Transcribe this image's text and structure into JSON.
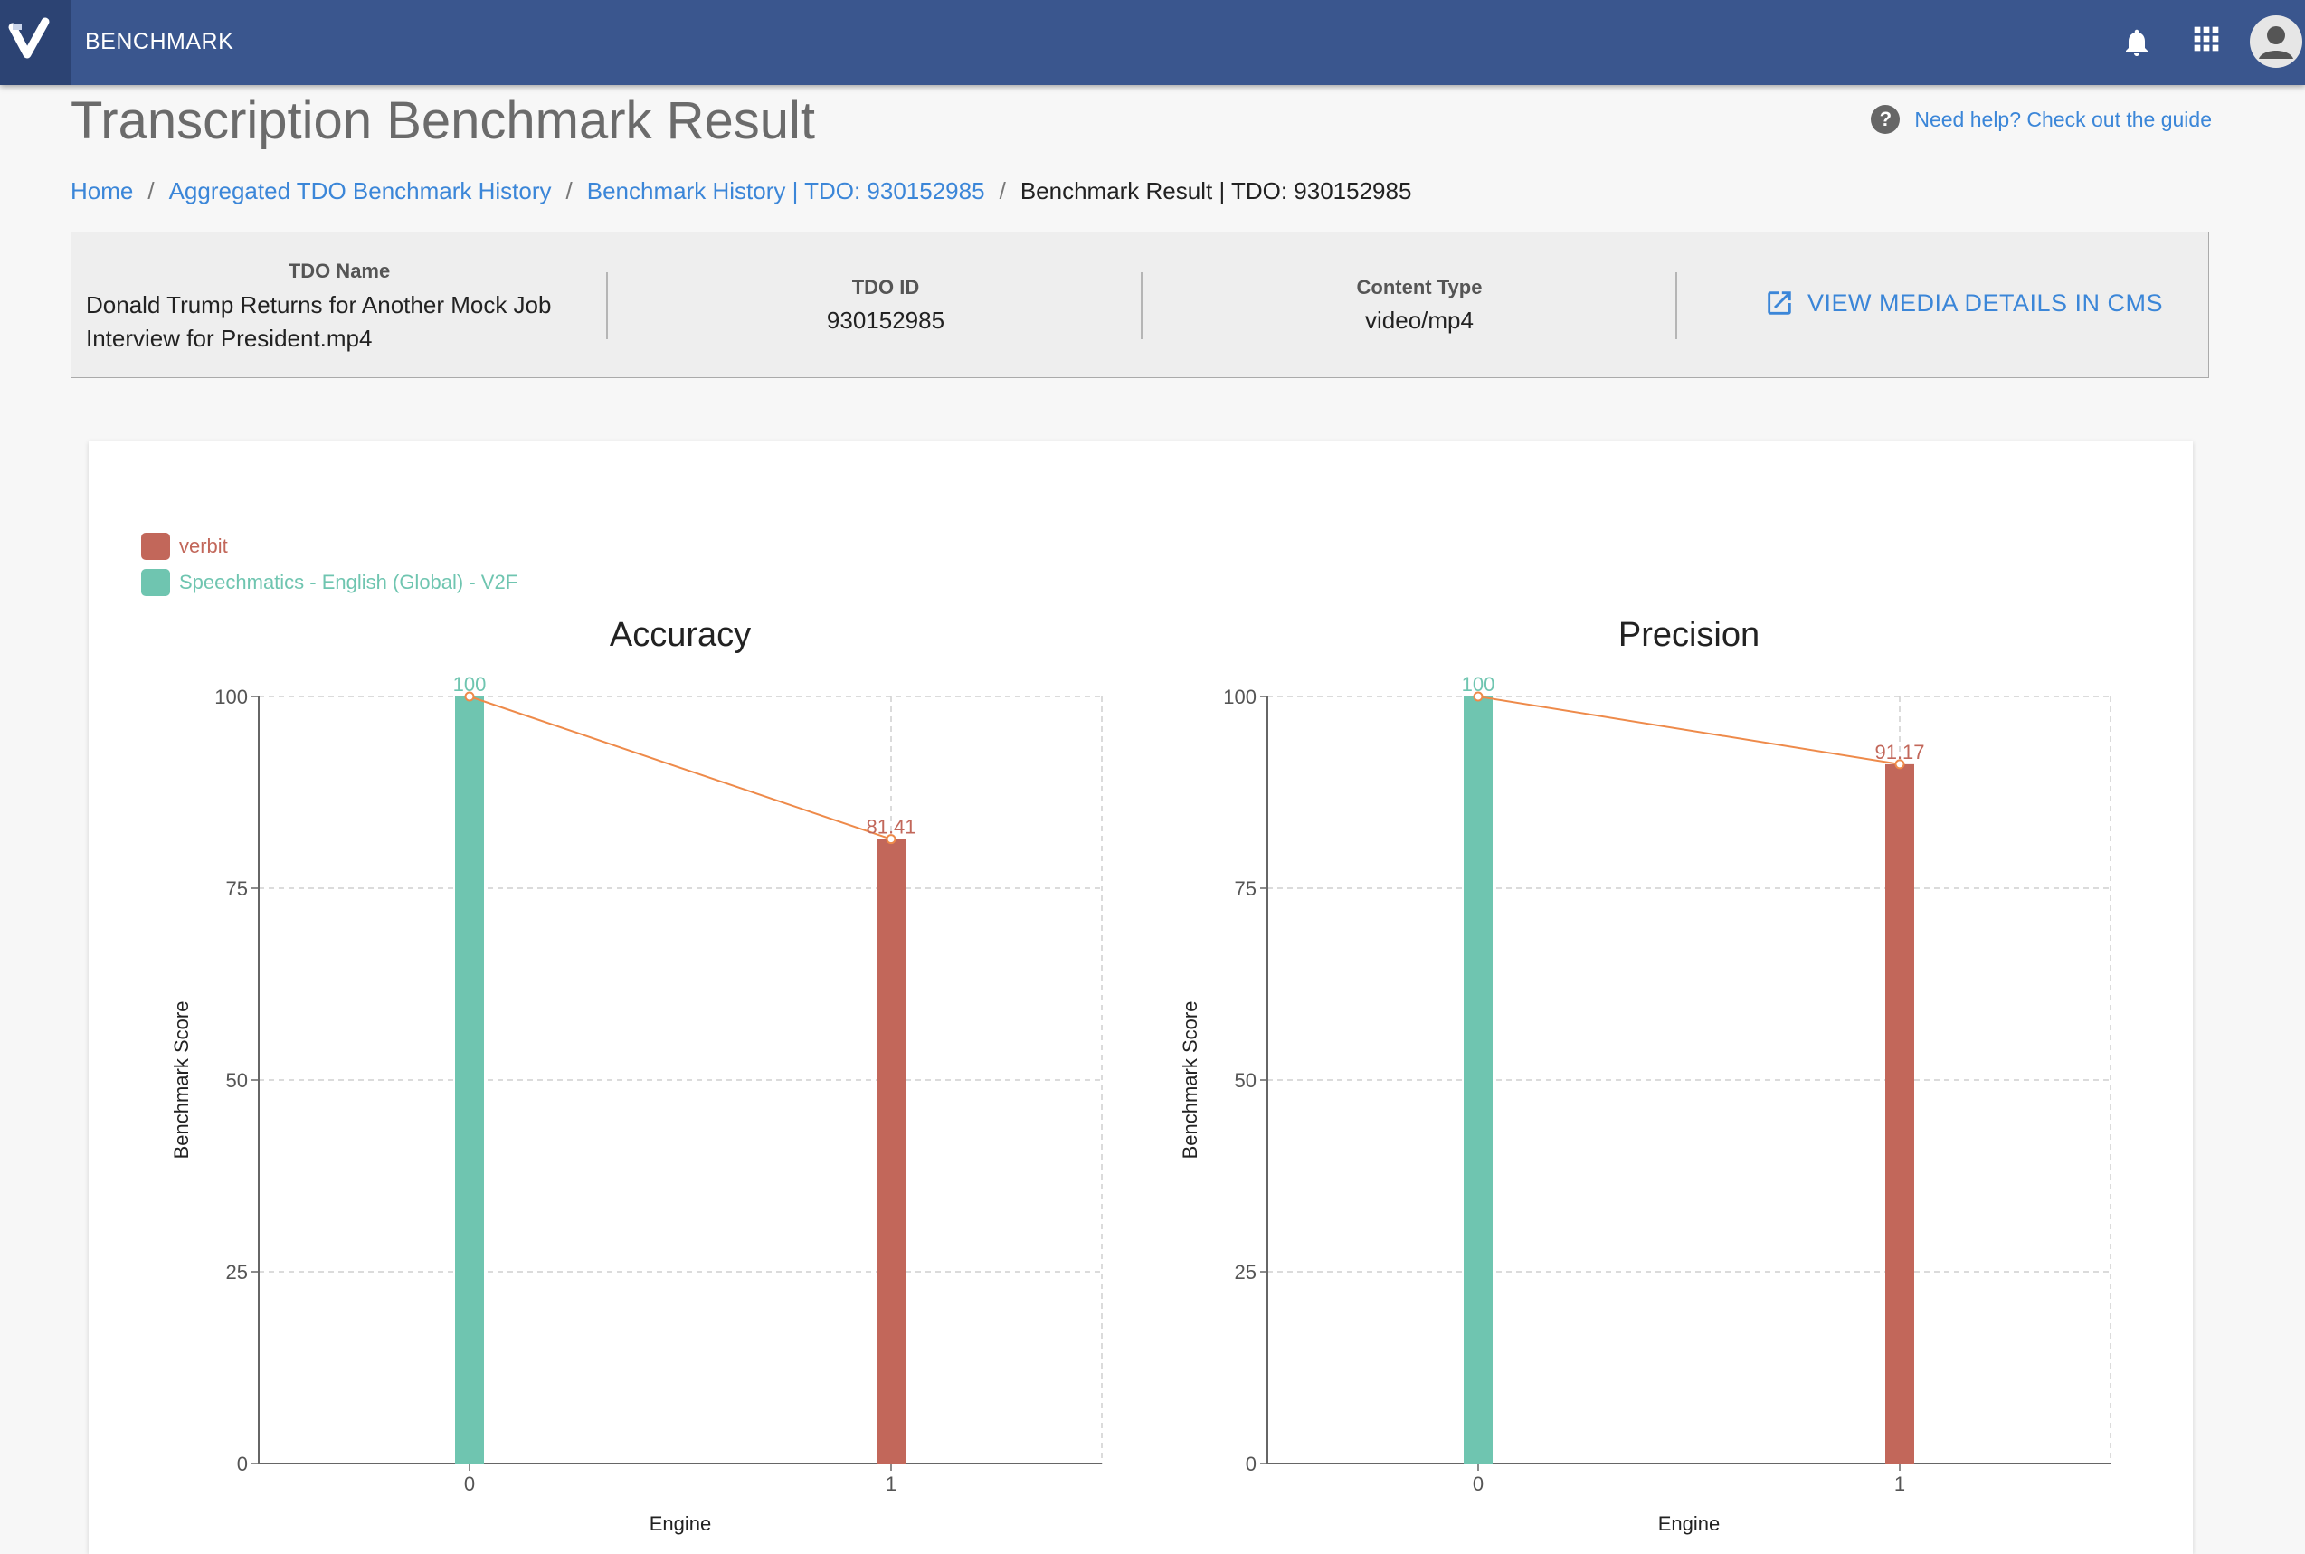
{
  "app": {
    "name": "BENCHMARK"
  },
  "page": {
    "title": "Transcription Benchmark Result"
  },
  "help": {
    "text": "Need help? Check out the guide"
  },
  "breadcrumb": [
    {
      "label": "Home"
    },
    {
      "label": "Aggregated TDO Benchmark History"
    },
    {
      "label": "Benchmark History | TDO: 930152985"
    },
    {
      "label": "Benchmark Result | TDO: 930152985"
    }
  ],
  "info": {
    "tdo_name_label": "TDO Name",
    "tdo_name_line1": "Donald Trump Returns for Another Mock Job",
    "tdo_name_line2": "Interview for President.mp4",
    "tdo_id_label": "TDO ID",
    "tdo_id": "930152985",
    "content_type_label": "Content Type",
    "content_type": "video/mp4",
    "cms_link": "VIEW MEDIA DETAILS IN CMS"
  },
  "legend": [
    {
      "label": "verbit",
      "color": "#c2675a"
    },
    {
      "label": "Speechmatics - English (Global) - V2F",
      "color": "#6fc5b0"
    }
  ],
  "colors": {
    "header": "#3a568e",
    "link": "#3b86d8",
    "line": "#ee8a4a"
  },
  "chart_data": [
    {
      "type": "bar",
      "title": "Accuracy",
      "xlabel": "Engine",
      "ylabel": "Benchmark Score",
      "categories": [
        "0",
        "1"
      ],
      "values": [
        100,
        81.41
      ],
      "labels": [
        "100",
        "81.41"
      ],
      "bar_colors": [
        "#6fc5b0",
        "#c2675a"
      ],
      "line_overlay": true,
      "ylim": [
        0,
        100
      ],
      "yticks": [
        0,
        25,
        50,
        75,
        100
      ],
      "grid": true
    },
    {
      "type": "bar",
      "title": "Precision",
      "xlabel": "Engine",
      "ylabel": "Benchmark Score",
      "categories": [
        "0",
        "1"
      ],
      "values": [
        100,
        91.17
      ],
      "labels": [
        "100",
        "91.17"
      ],
      "bar_colors": [
        "#6fc5b0",
        "#c2675a"
      ],
      "line_overlay": true,
      "ylim": [
        0,
        100
      ],
      "yticks": [
        0,
        25,
        50,
        75,
        100
      ],
      "grid": true
    }
  ]
}
